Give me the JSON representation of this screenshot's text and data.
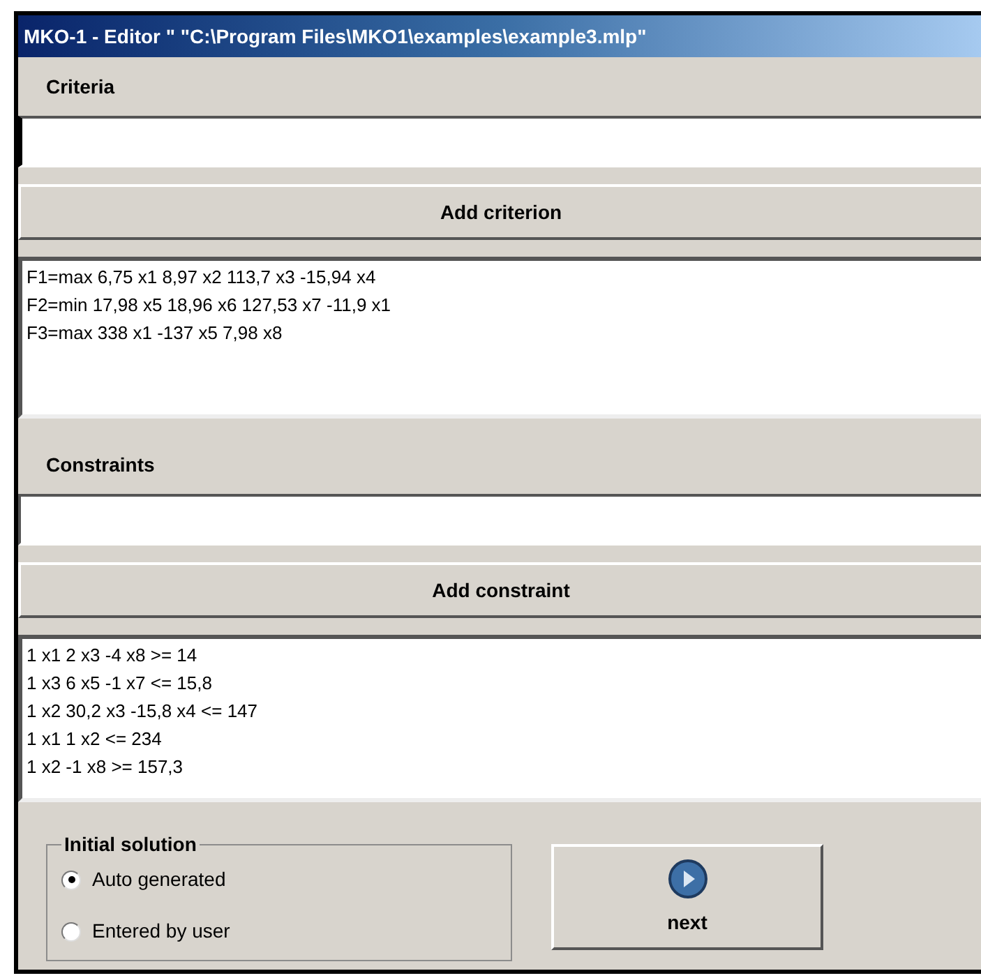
{
  "window": {
    "title": "MKO-1 - Editor \" \"C:\\Program Files\\MKO1\\examples\\example3.mlp\""
  },
  "criteria": {
    "label": "Criteria",
    "focused": true,
    "button": "Add criterion",
    "items": [
      "F1=max 6,75 x1 8,97 x2 113,7 x3 -15,94 x4",
      "F2=min 17,98 x5 18,96 x6 127,53 x7 -11,9 x1",
      "F3=max 338 x1 -137 x5 7,98 x8"
    ]
  },
  "constraints": {
    "label": "Constraints",
    "focused": false,
    "button": "Add constraint",
    "items": [
      "1 x1 2 x3 -4 x8 >= 14",
      "1 x3 6 x5 -1 x7 <= 15,8",
      "1 x2 30,2 x3 -15,8 x4 <= 147",
      "1 x1 1 x2 <= 234",
      "1 x2 -1 x8 >= 157,3"
    ]
  },
  "initial_solution": {
    "label": "Initial solution",
    "options": [
      {
        "label": "Auto generated",
        "selected": true
      },
      {
        "label": "Entered by user",
        "selected": false
      }
    ]
  },
  "next_button": {
    "label": "next"
  }
}
